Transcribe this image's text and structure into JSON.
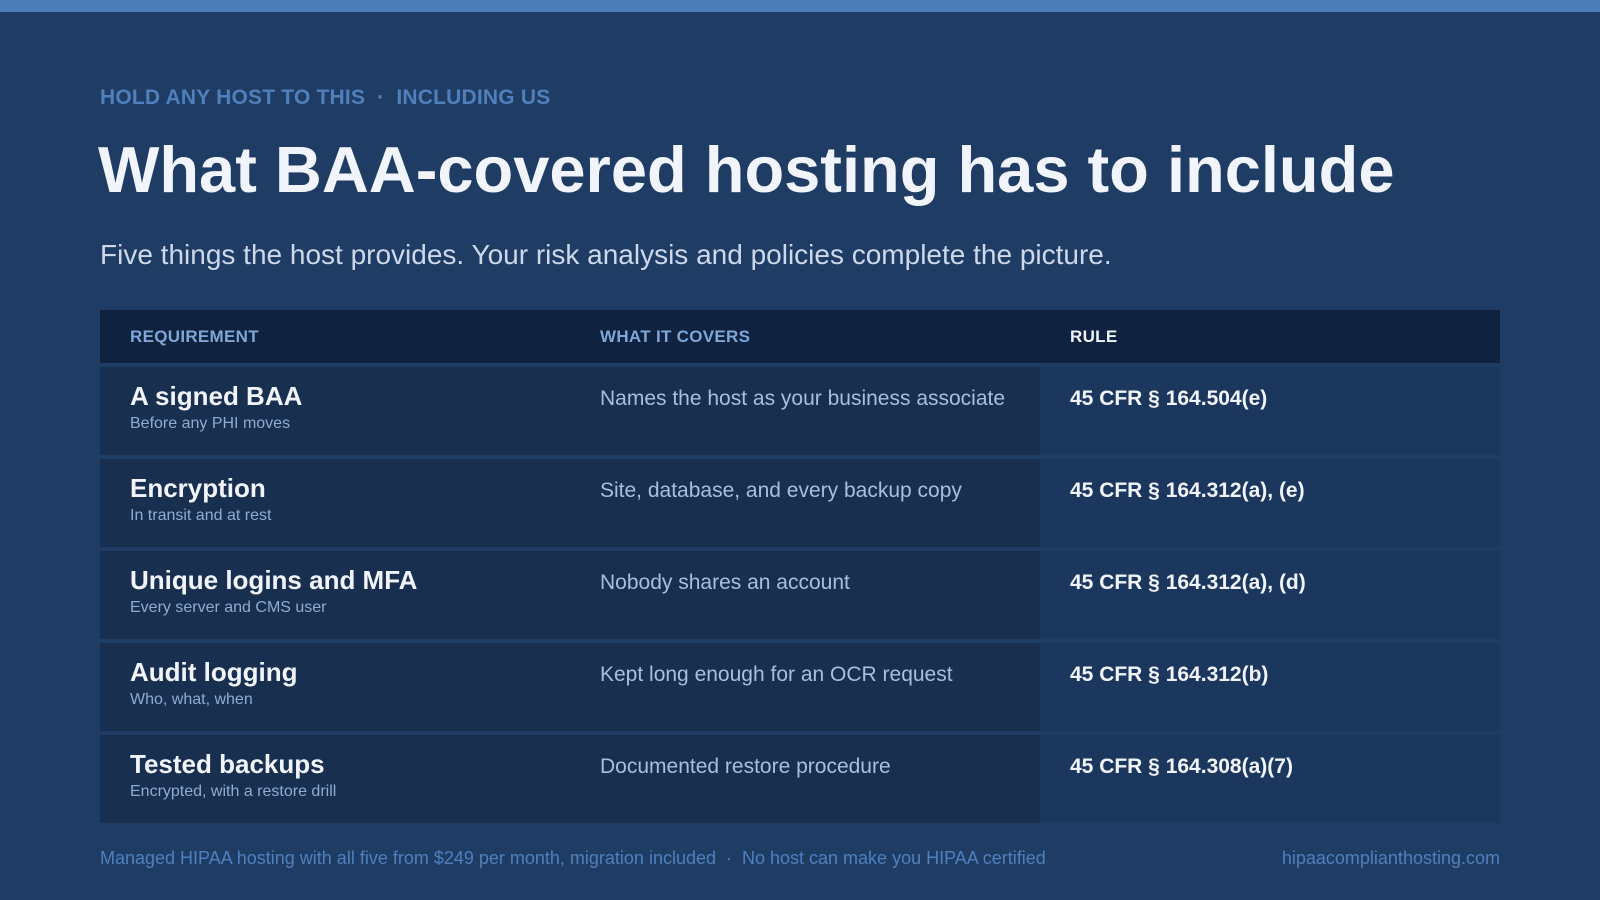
{
  "eyebrow": {
    "part1": "HOLD ANY HOST TO THIS",
    "separator": "·",
    "part2": "INCLUDING US"
  },
  "title": "What BAA-covered hosting has to include",
  "subtitle": "Five things the host provides. Your risk analysis and policies complete the picture.",
  "table": {
    "headers": {
      "requirement": "REQUIREMENT",
      "covers": "WHAT IT COVERS",
      "rule": "RULE"
    },
    "rows": [
      {
        "name": "A signed BAA",
        "sub": "Before any PHI moves",
        "covers": "Names the host as your business associate",
        "rule": "45 CFR § 164.504(e)"
      },
      {
        "name": "Encryption",
        "sub": "In transit and at rest",
        "covers": "Site, database, and every backup copy",
        "rule": "45 CFR § 164.312(a), (e)"
      },
      {
        "name": "Unique logins and MFA",
        "sub": "Every server and CMS user",
        "covers": "Nobody shares an account",
        "rule": "45 CFR § 164.312(a), (d)"
      },
      {
        "name": "Audit logging",
        "sub": "Who, what, when",
        "covers": "Kept long enough for an OCR request",
        "rule": "45 CFR § 164.312(b)"
      },
      {
        "name": "Tested backups",
        "sub": "Encrypted, with a restore drill",
        "covers": "Documented restore procedure",
        "rule": "45 CFR § 164.308(a)(7)"
      }
    ]
  },
  "footer": {
    "left_part1": "Managed HIPAA hosting with all five from $249 per month, migration included",
    "separator": "·",
    "left_part2": "No host can make you HIPAA certified",
    "site": "hipaacomplianthosting.com"
  },
  "colors": {
    "background": "#1f3c64",
    "accent": "#4a7cb5",
    "header_row": "#0f2340",
    "row_band": "#182f50",
    "title_text": "#f1f5fb"
  }
}
